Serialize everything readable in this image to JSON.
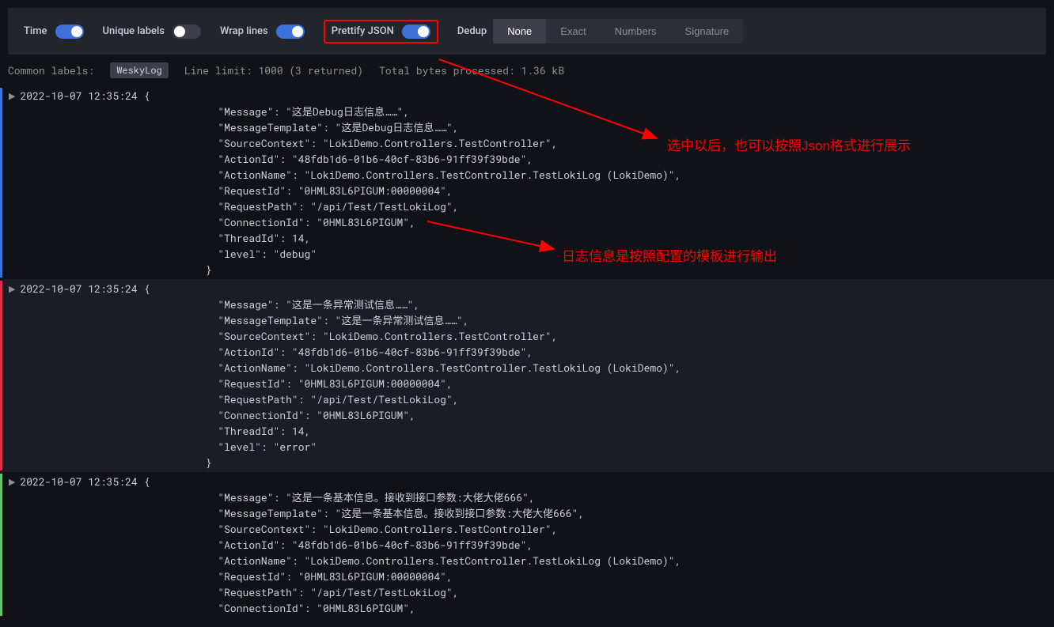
{
  "toolbar": {
    "time_label": "Time",
    "unique_labels_label": "Unique labels",
    "wrap_lines_label": "Wrap lines",
    "prettify_json_label": "Prettify JSON",
    "dedup_label": "Dedup",
    "dedup_options": {
      "none": "None",
      "exact": "Exact",
      "numbers": "Numbers",
      "signature": "Signature"
    }
  },
  "meta": {
    "common_labels_label": "Common labels:",
    "common_labels_value": "WeskyLog",
    "line_limit_label": "Line limit:",
    "line_limit_value": "1000 (3 returned)",
    "bytes_label": "Total bytes processed:",
    "bytes_value": "1.36 kB"
  },
  "annotations": {
    "a1": "选中以后，也可以按照Json格式进行展示",
    "a2": "日志信息是按照配置的模板进行输出"
  },
  "logs": [
    {
      "level": "debug",
      "timestamp": "2022-10-07 12:35:24",
      "body": "{\n            \"Message\": \"这是Debug日志信息……\",\n            \"MessageTemplate\": \"这是Debug日志信息……\",\n            \"SourceContext\": \"LokiDemo.Controllers.TestController\",\n            \"ActionId\": \"48fdb1d6-01b6-40cf-83b6-91ff39f39bde\",\n            \"ActionName\": \"LokiDemo.Controllers.TestController.TestLokiLog (LokiDemo)\",\n            \"RequestId\": \"0HML83L6PIGUM:00000004\",\n            \"RequestPath\": \"/api/Test/TestLokiLog\",\n            \"ConnectionId\": \"0HML83L6PIGUM\",\n            \"ThreadId\": 14,\n            \"level\": \"debug\"\n          }"
    },
    {
      "level": "error",
      "timestamp": "2022-10-07 12:35:24",
      "body": "{\n            \"Message\": \"这是一条异常测试信息……\",\n            \"MessageTemplate\": \"这是一条异常测试信息……\",\n            \"SourceContext\": \"LokiDemo.Controllers.TestController\",\n            \"ActionId\": \"48fdb1d6-01b6-40cf-83b6-91ff39f39bde\",\n            \"ActionName\": \"LokiDemo.Controllers.TestController.TestLokiLog (LokiDemo)\",\n            \"RequestId\": \"0HML83L6PIGUM:00000004\",\n            \"RequestPath\": \"/api/Test/TestLokiLog\",\n            \"ConnectionId\": \"0HML83L6PIGUM\",\n            \"ThreadId\": 14,\n            \"level\": \"error\"\n          }"
    },
    {
      "level": "info",
      "timestamp": "2022-10-07 12:35:24",
      "body": "{\n            \"Message\": \"这是一条基本信息。接收到接口参数:大佬大佬666\",\n            \"MessageTemplate\": \"这是一条基本信息。接收到接口参数:大佬大佬666\",\n            \"SourceContext\": \"LokiDemo.Controllers.TestController\",\n            \"ActionId\": \"48fdb1d6-01b6-40cf-83b6-91ff39f39bde\",\n            \"ActionName\": \"LokiDemo.Controllers.TestController.TestLokiLog (LokiDemo)\",\n            \"RequestId\": \"0HML83L6PIGUM:00000004\",\n            \"RequestPath\": \"/api/Test/TestLokiLog\",\n            \"ConnectionId\": \"0HML83L6PIGUM\","
    }
  ]
}
